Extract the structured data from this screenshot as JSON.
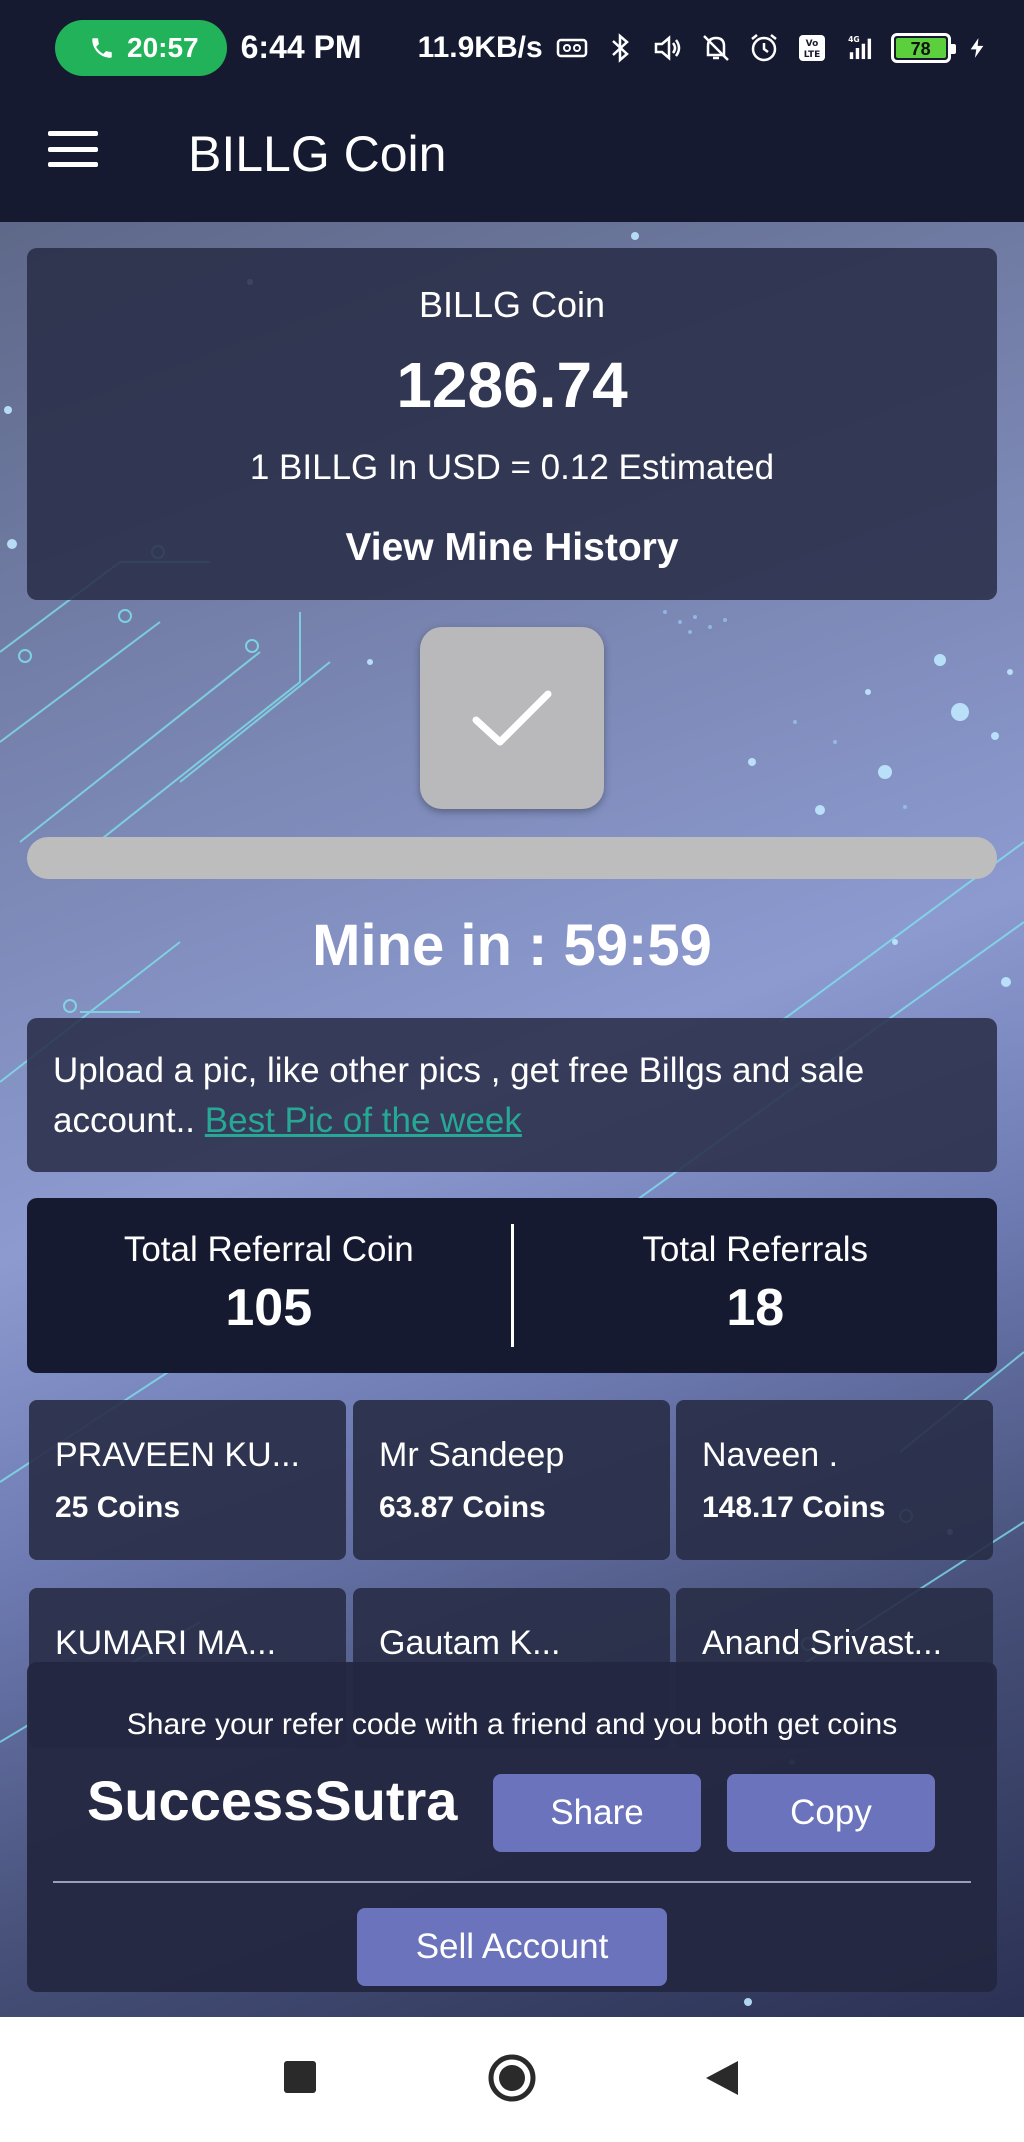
{
  "status_bar": {
    "call_time": "20:57",
    "clock": "6:44 PM",
    "network_speed": "11.9KB/s",
    "battery_level": "78",
    "network_type": "4G",
    "icons": [
      "phone-icon",
      "vr-icon",
      "bluetooth-icon",
      "volume-icon",
      "bell-off-icon",
      "alarm-icon",
      "volte-icon",
      "signal-icon",
      "battery-icon",
      "charging-icon"
    ]
  },
  "app_bar": {
    "title": "BILLG Coin",
    "menu_icon": "hamburger-menu-icon"
  },
  "balance": {
    "label": "BILLG Coin",
    "amount": "1286.74",
    "rate_text": "1 BILLG In USD = 0.12 Estimated",
    "history_link": "View Mine History"
  },
  "mine": {
    "button_icon": "checkmark-icon",
    "progress": 0,
    "timer_text": "Mine in : 59:59"
  },
  "upload": {
    "text": "Upload a pic, like other pics , get free Billgs and sale account..",
    "link": "Best Pic of the week"
  },
  "referral_stats": {
    "coin_label": "Total Referral Coin",
    "coin_value": "105",
    "count_label": "Total Referrals",
    "count_value": "18"
  },
  "referrals": [
    {
      "name": "PRAVEEN KU...",
      "coins": "25 Coins"
    },
    {
      "name": "Mr Sandeep",
      "coins": "63.87 Coins"
    },
    {
      "name": "Naveen .",
      "coins": "148.17 Coins"
    },
    {
      "name": "KUMARI MA...",
      "coins": ""
    },
    {
      "name": "Gautam K...",
      "coins": ""
    },
    {
      "name": "Anand Srivast...",
      "coins": ""
    }
  ],
  "share": {
    "hint": "Share your refer code with a friend and you both get coins",
    "code": "SuccessSutra",
    "share_label": "Share",
    "copy_label": "Copy",
    "sell_label": "Sell Account"
  },
  "nav": {
    "icons": [
      "recents-square-icon",
      "home-circle-icon",
      "back-triangle-icon"
    ]
  },
  "colors": {
    "header_bg": "#151a30",
    "button_bg": "#6a73bb",
    "link": "#27a894",
    "call_pill": "#22b35a"
  }
}
